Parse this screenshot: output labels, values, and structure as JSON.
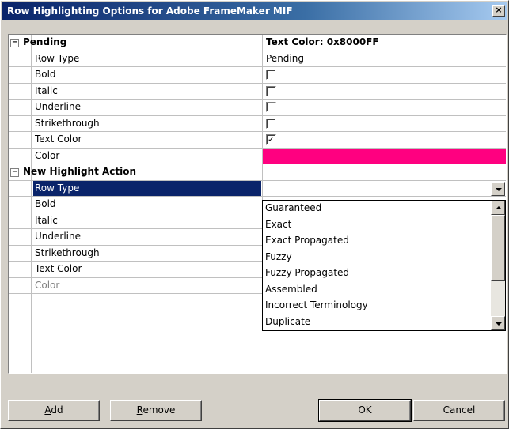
{
  "window": {
    "title": "Row Highlighting Options for Adobe FrameMaker MIF",
    "close_glyph": "×"
  },
  "grid": {
    "expand_glyph": "−",
    "check_glyph": "✓",
    "pending": {
      "name": "Pending",
      "value": "Text Color: 0x8000FF",
      "rows": [
        {
          "name": "Row Type",
          "value": "Pending"
        },
        {
          "name": "Bold",
          "checked": false
        },
        {
          "name": "Italic",
          "checked": false
        },
        {
          "name": "Underline",
          "checked": false
        },
        {
          "name": "Strikethrough",
          "checked": false
        },
        {
          "name": "Text Color",
          "checked": true
        },
        {
          "name": "Color",
          "swatch": "#ff0080"
        }
      ]
    },
    "new_action": {
      "name": "New Highlight Action",
      "rows": [
        {
          "name": "Row Type",
          "value": ""
        },
        {
          "name": "Bold"
        },
        {
          "name": "Italic"
        },
        {
          "name": "Underline"
        },
        {
          "name": "Strikethrough"
        },
        {
          "name": "Text Color"
        },
        {
          "name": "Color"
        }
      ]
    }
  },
  "dropdown": {
    "options": [
      "Guaranteed",
      "Exact",
      "Exact Propagated",
      "Fuzzy",
      "Fuzzy Propagated",
      "Assembled",
      "Incorrect Terminology",
      "Duplicate"
    ]
  },
  "buttons": {
    "add": {
      "mnemonic": "A",
      "rest": "dd"
    },
    "remove": {
      "mnemonic": "R",
      "rest": "emove"
    },
    "ok": "OK",
    "cancel": "Cancel"
  },
  "colors": {
    "selection": "#0a246a",
    "swatch": "#ff0080"
  }
}
